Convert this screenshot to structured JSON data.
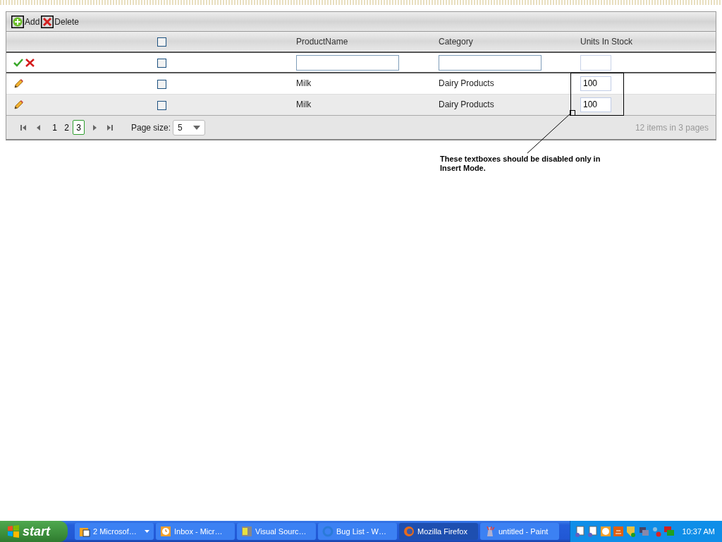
{
  "toolbar": [
    {
      "kind": "add",
      "label": "Add"
    },
    {
      "kind": "delete",
      "label": "Delete"
    }
  ],
  "columns": [
    {
      "kind": "actions"
    },
    {
      "kind": "select",
      "checked": false
    },
    {
      "kind": "text",
      "label": "ProductName"
    },
    {
      "kind": "text",
      "label": "Category"
    },
    {
      "kind": "text",
      "label": "Units In Stock"
    }
  ],
  "insert_row": {
    "checked": false,
    "fields": [
      {
        "disabled": false
      },
      {
        "disabled": false
      },
      {
        "disabled": true
      }
    ]
  },
  "rows": [
    {
      "checked": false,
      "product": "Milk",
      "category": "Dairy Products",
      "units": "100"
    },
    {
      "checked": false,
      "product": "Milk",
      "category": "Dairy Products",
      "units": "100"
    }
  ],
  "pager": {
    "pages": [
      {
        "label": "1",
        "selected": false
      },
      {
        "label": "2",
        "selected": false
      },
      {
        "label": "3",
        "selected": true
      }
    ],
    "page_size_label": "Page size:",
    "page_size": "5",
    "summary": "12 items in 3 pages"
  },
  "annotation": {
    "text": "These textboxes should be disabled only in Insert Mode."
  },
  "taskbar": {
    "start": "start",
    "tasks": [
      {
        "label": "2 Microsof…",
        "kind": "group",
        "selected": false
      },
      {
        "label": "Inbox - Micr…",
        "kind": "window",
        "selected": false
      },
      {
        "label": "Visual Sourc…",
        "kind": "window",
        "selected": false
      },
      {
        "label": "Bug List - W…",
        "kind": "window",
        "selected": false
      },
      {
        "label": "Mozilla Firefox",
        "kind": "window",
        "selected": true
      },
      {
        "label": "untitled - Paint",
        "kind": "window",
        "selected": false
      }
    ],
    "clock": "10:37 AM"
  }
}
